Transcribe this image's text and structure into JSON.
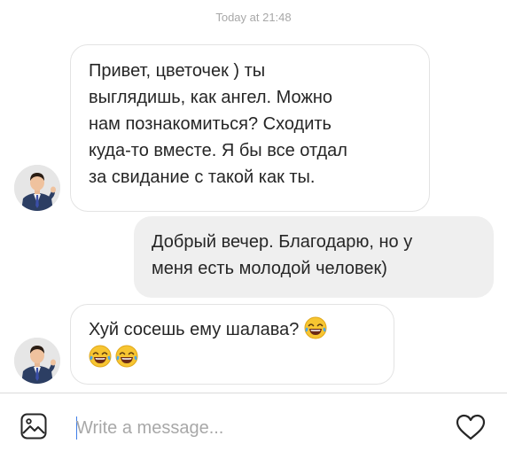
{
  "header": {
    "timestamp": "Today at 21:48"
  },
  "messages": [
    {
      "direction": "incoming",
      "lines": [
        "Привет, цветочек ) ты",
        "выглядишь, как ангел. Можно",
        "нам познакомиться? Сходить",
        "куда-то вместе. Я бы все отдал",
        "за свидание с такой как ты."
      ]
    },
    {
      "direction": "outgoing",
      "lines": [
        "Добрый вечер. Благодарю, но у",
        "меня есть молодой человек)"
      ]
    },
    {
      "direction": "incoming",
      "lines": [
        "Хуй сосешь ему шалава?"
      ],
      "emoji": "face-with-tears-of-joy"
    }
  ],
  "composer": {
    "placeholder": "Write a message...",
    "left_icon": "image-gallery-icon",
    "right_icon": "heart-icon"
  },
  "colors": {
    "incoming_border": "#e3e3e3",
    "outgoing_bg": "#efefef",
    "timestamp": "#a8a8a8",
    "caret": "#3f7ee8"
  }
}
